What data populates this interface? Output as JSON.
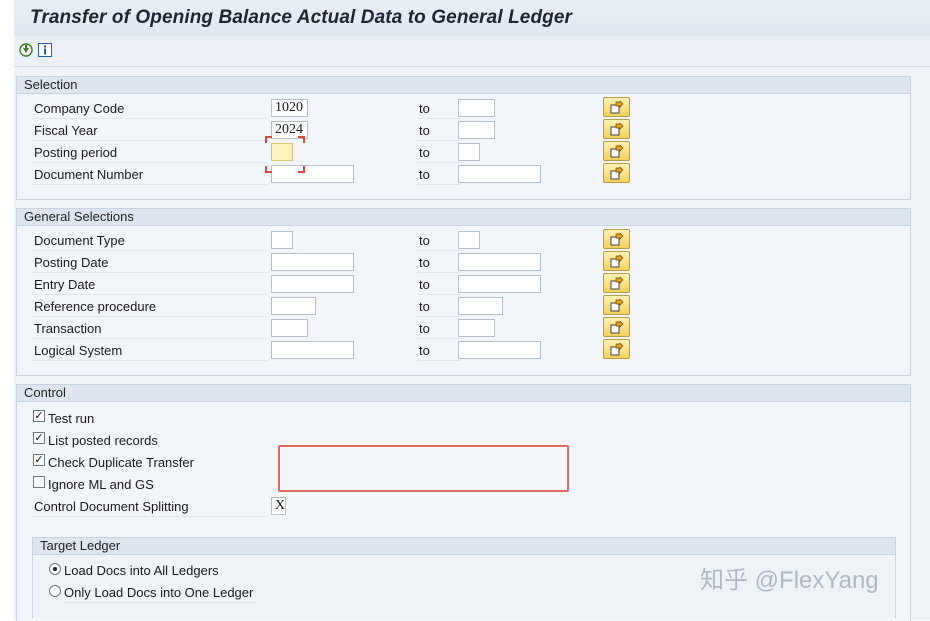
{
  "window": {
    "title": "Transfer of Opening Balance Actual Data to General Ledger"
  },
  "toolbar": {
    "execute_icon": "execute-icon",
    "info_icon": "info-icon"
  },
  "selection": {
    "title": "Selection",
    "rows": [
      {
        "label": "Company Code",
        "low": "1020",
        "high": "",
        "to": "to"
      },
      {
        "label": "Fiscal Year",
        "low": "2024",
        "high": "",
        "to": "to"
      },
      {
        "label": "Posting period",
        "low": "",
        "high": "",
        "to": "to"
      },
      {
        "label": "Document Number",
        "low": "",
        "high": "",
        "to": "to"
      }
    ]
  },
  "general": {
    "title": "General Selections",
    "rows": [
      {
        "label": "Document Type",
        "low": "",
        "high": "",
        "to": "to"
      },
      {
        "label": "Posting Date",
        "low": "",
        "high": "",
        "to": "to"
      },
      {
        "label": "Entry Date",
        "low": "",
        "high": "",
        "to": "to"
      },
      {
        "label": "Reference procedure",
        "low": "",
        "high": "",
        "to": "to"
      },
      {
        "label": "Transaction",
        "low": "",
        "high": "",
        "to": "to"
      },
      {
        "label": "Logical System",
        "low": "",
        "high": "",
        "to": "to"
      }
    ]
  },
  "control": {
    "title": "Control",
    "checkboxes": [
      {
        "label": "Test run",
        "checked": true
      },
      {
        "label": "List posted records",
        "checked": true
      },
      {
        "label": "Check Duplicate Transfer",
        "checked": true
      },
      {
        "label": "Ignore ML and GS",
        "checked": false
      }
    ],
    "splitting": {
      "label": "Control Document Splitting",
      "value": "X"
    },
    "target_ledger": {
      "title": "Target Ledger",
      "options": [
        {
          "label": "Load Docs into All Ledgers",
          "selected": true
        },
        {
          "label": "Only Load Docs into One Ledger",
          "selected": false
        }
      ]
    }
  },
  "watermark": "知乎 @FlexYang",
  "colors": {
    "highlight_box": "#dd6a5d",
    "required_field": "#fdf1bb",
    "group_header": "#dde6ef"
  }
}
